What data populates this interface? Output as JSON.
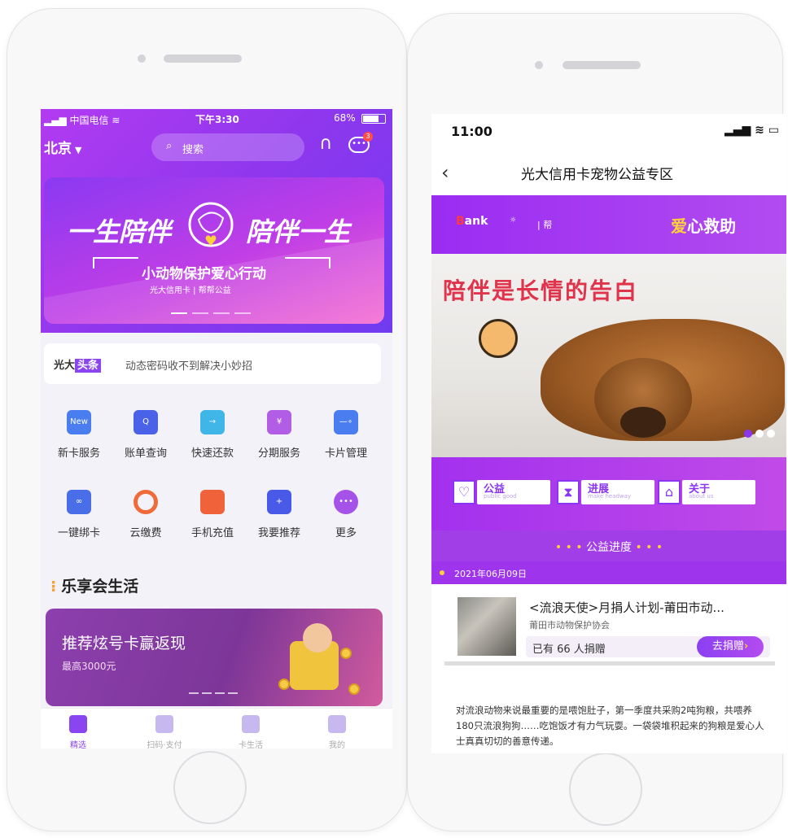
{
  "left_phone": {
    "status": {
      "carrier": "中国电信",
      "time": "下午3:30",
      "battery": "68%"
    },
    "header": {
      "city": "北京",
      "search_placeholder": "搜索",
      "message_badge": "3"
    },
    "banner": {
      "title_left": "一生陪伴",
      "title_right": "陪伴一生",
      "subtitle": "小动物保护爱心行动",
      "logo_text": "光大信用卡 | 帮帮公益"
    },
    "notice": {
      "brand_prefix": "光大",
      "brand_tag": "头条",
      "text": "动态密码收不到解决小妙招"
    },
    "services": [
      {
        "label": "新卡服务",
        "tag": "",
        "icon_label": "New",
        "icon": "new-card-icon",
        "color": "#4a7df0"
      },
      {
        "label": "账单查询",
        "tag": "",
        "icon_label": "Q",
        "icon": "bill-query-icon",
        "color": "#4a62e8"
      },
      {
        "label": "快速还款",
        "tag": "",
        "icon_label": "→",
        "icon": "quick-repay-icon",
        "color": "#3fb5e8"
      },
      {
        "label": "分期服务",
        "tag": "",
        "icon_label": "¥",
        "icon": "installment-icon",
        "color": "#b25de6"
      },
      {
        "label": "卡片管理",
        "tag": "",
        "icon_label": "—∘",
        "icon": "card-manage-icon",
        "color": "#4a7df0"
      },
      {
        "label": "一键绑卡",
        "tag": "",
        "icon_label": "∞",
        "icon": "bind-card-icon",
        "color": "#4a6de8"
      },
      {
        "label": "云缴费",
        "tag": "",
        "icon_label": "",
        "icon": "cloud-pay-icon",
        "color": "#f06a3a"
      },
      {
        "label": "手机充值",
        "tag": "",
        "icon_label": "",
        "icon": "phone-topup-icon",
        "color": "#f0633a"
      },
      {
        "label": "我要推荐",
        "tag": "",
        "icon_label": "+",
        "icon": "recommend-icon",
        "color": "#4a5ae8"
      },
      {
        "label": "更多",
        "tag": "",
        "icon_label": "•••",
        "icon": "more-icon",
        "color": "#a552e8"
      }
    ],
    "section_title": "乐享会生活",
    "promo": {
      "title": "推荐炫号卡赢返现",
      "subtitle": "最高3000元"
    },
    "tabs": [
      {
        "label": "精选",
        "icon": "featured-icon",
        "active": true
      },
      {
        "label": "扫码·支付",
        "icon": "scan-icon",
        "active": false
      },
      {
        "label": "卡生活",
        "icon": "card-life-icon",
        "active": false
      },
      {
        "label": "我的",
        "icon": "profile-icon",
        "active": false
      }
    ]
  },
  "right_phone": {
    "status": {
      "time": "11:00"
    },
    "nav": {
      "title": "光大信用卡宠物公益专区"
    },
    "header": {
      "bank_text": "ank",
      "bank_initial": "B",
      "aid_prefix": "爱",
      "aid_rest": "心救助"
    },
    "hero": {
      "headline": "陪伴是长情的告白"
    },
    "menu": [
      {
        "title": "公益",
        "subtitle": "public good",
        "icon": "heart-icon"
      },
      {
        "title": "进展",
        "subtitle": "make headway",
        "icon": "hourglass-icon"
      },
      {
        "title": "关于",
        "subtitle": "about us",
        "icon": "house-icon"
      }
    ],
    "progress_title": "公益进度",
    "date": "2021年06月09日",
    "donation": {
      "title": "<流浪天使>月捐人计划-莆田市动...",
      "org": "莆田市动物保护协会",
      "count_text": "已有 66 人捐赠",
      "button": "去捐赠"
    },
    "description": "对流浪动物来说最重要的是喂饱肚子，第一季度共采购2吨狗粮，共喂养180只流浪狗狗……吃饱饭才有力气玩耍。一袋袋堆积起来的狗粮是爱心人士真真切切的善意传递。"
  }
}
